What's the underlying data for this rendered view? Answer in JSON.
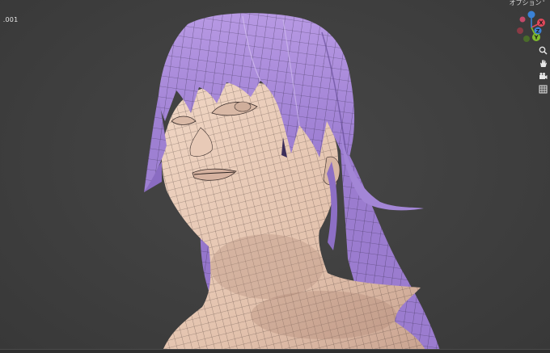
{
  "viewport": {
    "object_label": " .001",
    "options_label": "オプション",
    "options_chevron": "˅"
  },
  "gizmo": {
    "axis_x_label": "X",
    "axis_y_label": "Y",
    "axis_z_label": "Z",
    "colors": {
      "x": "#e2495b",
      "y": "#7fba2d",
      "z": "#3a82d6"
    }
  },
  "nav_icons": [
    "zoom-icon",
    "hand-pan-icon",
    "camera-view-icon",
    "grid-ortho-icon"
  ],
  "model_colors": {
    "hair": "#a98ad8",
    "hair_shadow": "#6f54a5",
    "skin": "#e6c7b3",
    "skin_shadow": "#b99382",
    "wire": "#2a2322"
  }
}
